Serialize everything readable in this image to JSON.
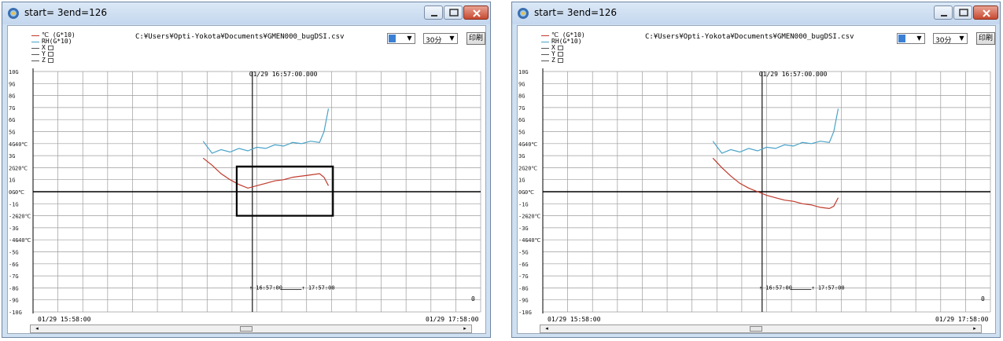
{
  "windows": [
    {
      "title": "start= 3end=126",
      "legend": [
        "℃ (G*10)",
        "RH(G*10)",
        "X",
        "Y",
        "Z"
      ],
      "filepath": "C:¥Users¥Opti-Yokota¥Documents¥GMEN000_bugDSI.csv",
      "axis_select": "",
      "time_select": "30分",
      "print_label": "印刷",
      "cursor_time": "01/29 16:57:00.000",
      "range_start": "16:57:00",
      "range_end": "17:57:00",
      "x_start": "01/29 15:58:00",
      "x_end": "01/29 17:58:00",
      "zero_label": "0",
      "highlight_box": true
    },
    {
      "title": "start= 3end=126",
      "legend": [
        "℃ (G*10)",
        "RH(G*10)",
        "X",
        "Y",
        "Z"
      ],
      "filepath": "C:¥Users¥Opti-Yokota¥Documents¥GMEN000_bugDSI.csv",
      "axis_select": "",
      "time_select": "30分",
      "print_label": "印刷",
      "cursor_time": "01/29 16:57:00.000",
      "range_start": "16:57:00",
      "range_end": "17:57:00",
      "x_start": "01/29 15:58:00",
      "x_end": "01/29 17:58:00",
      "zero_label": "0",
      "highlight_box": false
    }
  ],
  "y_g_labels": [
    "10G",
    "9G",
    "8G",
    "7G",
    "6G",
    "5G",
    "4G",
    "3G",
    "2G",
    "1G",
    "0G",
    "-1G",
    "-2G",
    "-3G",
    "-4G",
    "-5G",
    "-6G",
    "-7G",
    "-8G",
    "-9G",
    "-10G"
  ],
  "y_temp_labels": [
    {
      "g": 4,
      "text": "40℃"
    },
    {
      "g": 2,
      "text": "20℃"
    },
    {
      "g": 0,
      "text": "0℃"
    },
    {
      "g": -2,
      "text": "-20℃"
    },
    {
      "g": -4,
      "text": "-40℃"
    }
  ],
  "colors": {
    "temp": "#c0392b",
    "rh": "#4aa3c8",
    "title_bar": "#cfe0f1",
    "grid": "#9c9c9c",
    "axis": "#000000",
    "close_button": "#c74a31"
  },
  "chart_data": [
    {
      "type": "line",
      "xlabel": "",
      "ylabel": "",
      "ylim": [
        -10,
        10
      ],
      "series": [
        {
          "name": "RH(G*10)",
          "x": [
            0.38,
            0.4,
            0.42,
            0.44,
            0.46,
            0.48,
            0.5,
            0.52,
            0.54,
            0.56,
            0.58,
            0.6,
            0.62,
            0.64,
            0.65,
            0.66
          ],
          "values": [
            4.2,
            3.2,
            3.5,
            3.3,
            3.6,
            3.4,
            3.7,
            3.6,
            3.9,
            3.8,
            4.1,
            4.0,
            4.2,
            4.1,
            5.0,
            6.9
          ]
        },
        {
          "name": "℃ (G*10)",
          "x": [
            0.38,
            0.4,
            0.42,
            0.44,
            0.46,
            0.48,
            0.5,
            0.52,
            0.54,
            0.56,
            0.58,
            0.6,
            0.62,
            0.64,
            0.65,
            0.66
          ],
          "values": [
            2.8,
            2.2,
            1.5,
            1.0,
            0.6,
            0.3,
            0.5,
            0.7,
            0.9,
            1.0,
            1.2,
            1.3,
            1.4,
            1.5,
            1.2,
            0.5
          ]
        }
      ]
    },
    {
      "type": "line",
      "xlabel": "",
      "ylabel": "",
      "ylim": [
        -10,
        10
      ],
      "series": [
        {
          "name": "RH(G*10)",
          "x": [
            0.38,
            0.4,
            0.42,
            0.44,
            0.46,
            0.48,
            0.5,
            0.52,
            0.54,
            0.56,
            0.58,
            0.6,
            0.62,
            0.64,
            0.65,
            0.66
          ],
          "values": [
            4.2,
            3.2,
            3.5,
            3.3,
            3.6,
            3.4,
            3.7,
            3.6,
            3.9,
            3.8,
            4.1,
            4.0,
            4.2,
            4.1,
            5.0,
            6.9
          ]
        },
        {
          "name": "℃ (G*10)",
          "x": [
            0.38,
            0.4,
            0.42,
            0.44,
            0.46,
            0.48,
            0.5,
            0.52,
            0.54,
            0.56,
            0.58,
            0.6,
            0.62,
            0.64,
            0.65,
            0.66
          ],
          "values": [
            2.8,
            2.0,
            1.3,
            0.7,
            0.3,
            0.0,
            -0.3,
            -0.5,
            -0.7,
            -0.8,
            -1.0,
            -1.1,
            -1.3,
            -1.4,
            -1.2,
            -0.5
          ]
        }
      ]
    }
  ]
}
